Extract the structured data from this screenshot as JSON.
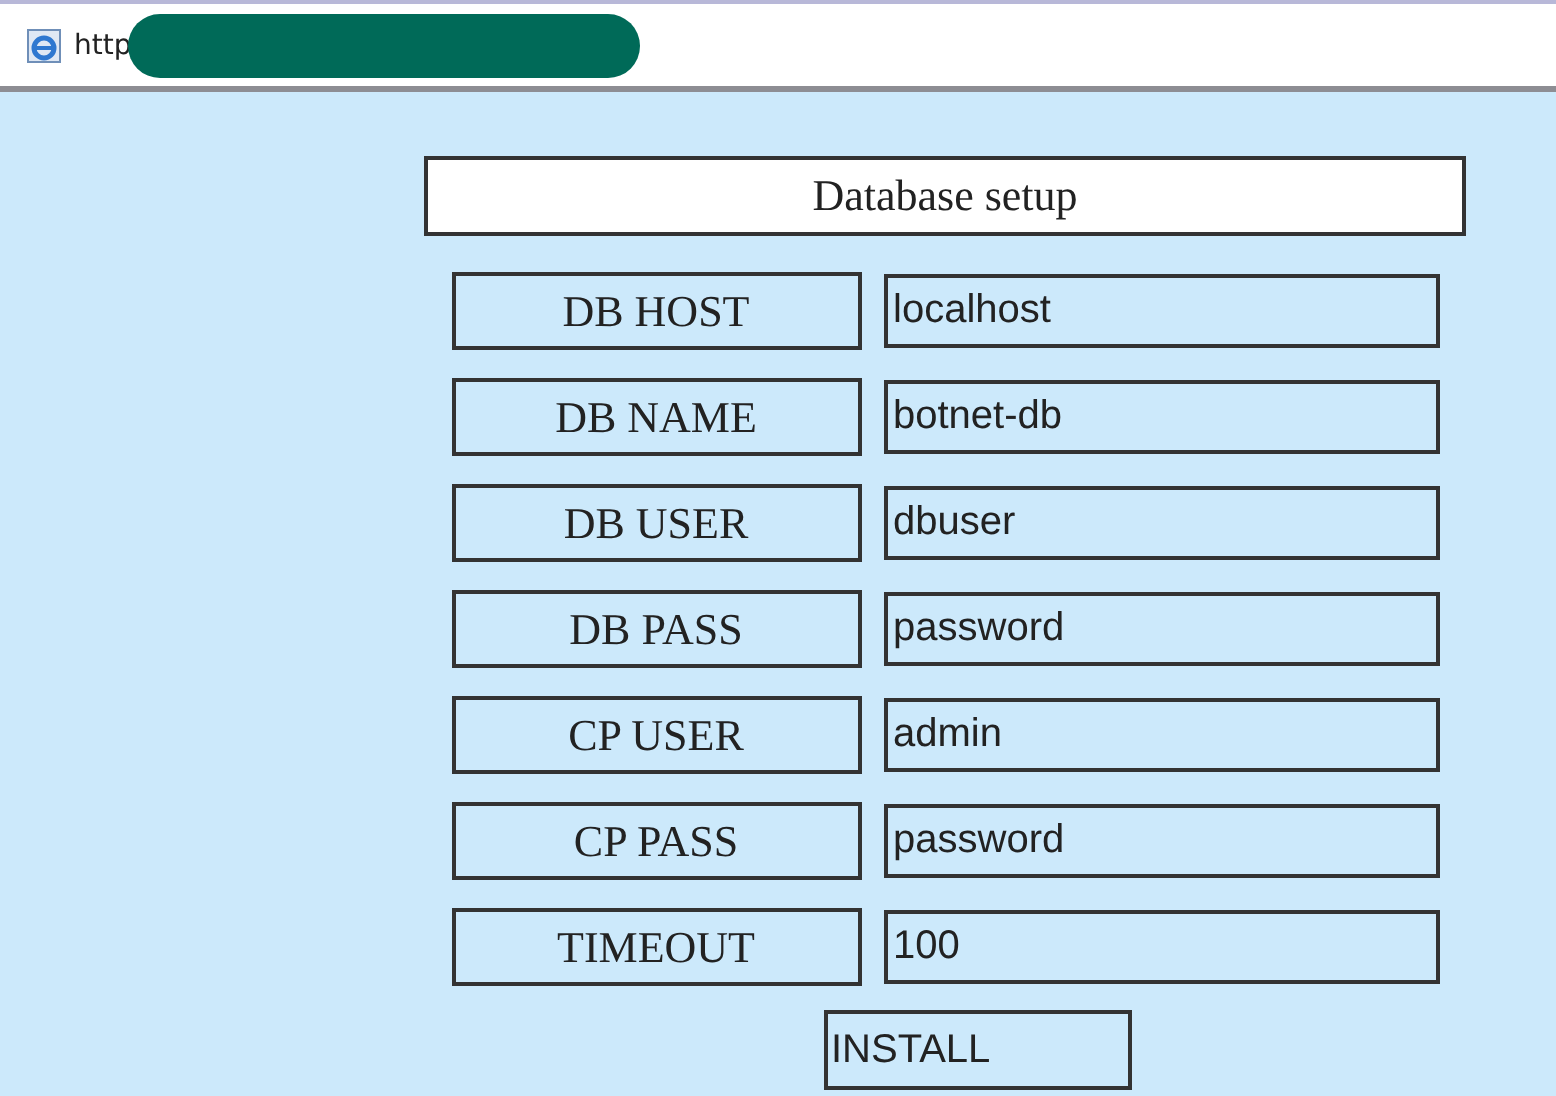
{
  "address_bar": {
    "text": "http"
  },
  "form": {
    "title": "Database setup",
    "fields": [
      {
        "label": "DB HOST",
        "value": "localhost"
      },
      {
        "label": "DB NAME",
        "value": "botnet-db"
      },
      {
        "label": "DB USER",
        "value": "dbuser"
      },
      {
        "label": "DB PASS",
        "value": "password"
      },
      {
        "label": "CP USER",
        "value": "admin"
      },
      {
        "label": "CP PASS",
        "value": "password"
      },
      {
        "label": "TIMEOUT",
        "value": "100"
      }
    ],
    "button": "INSTALL"
  }
}
